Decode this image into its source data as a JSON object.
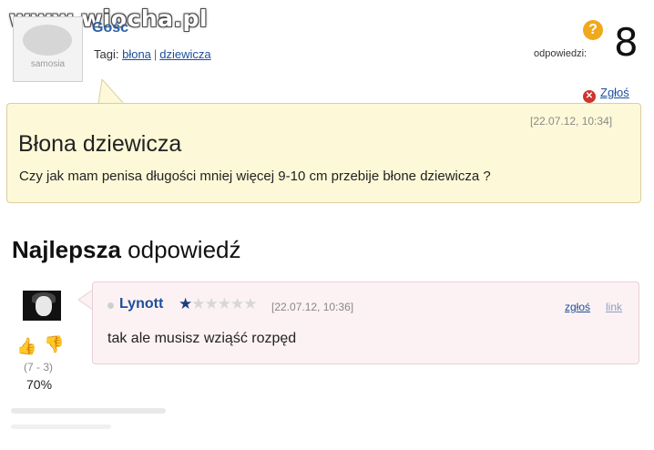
{
  "watermark": "www.wiocha.pl",
  "question": {
    "avatar_label": "samosia",
    "user_name": "Gośc",
    "tags_label": "Tagi:",
    "tags": [
      "błona",
      "dziewicza"
    ],
    "answers_label": "odpowiedzi:",
    "answers_count": "8",
    "badge": "?",
    "report_label": "Zgłoś",
    "date": "[22.07.12, 10:34]",
    "title": "Błona dziewicza",
    "body": "Czy jak mam penisa długości mniej więcej 9-10 cm przebije błone dziewicza ?"
  },
  "best_answer": {
    "heading_bold": "Najlepsza",
    "heading_rest": " odpowiedź",
    "user_name": "Lynott",
    "rating": {
      "stars_on": 1,
      "stars_total": 6
    },
    "date": "[22.07.12, 10:36]",
    "report_label": "zgłoś",
    "link_label": "link",
    "body": "tak ale musisz wziąść rozpęd",
    "votes": {
      "count": "(7 - 3)",
      "percent": "70%"
    }
  },
  "colors": {
    "question_bg": "#fdf9d8",
    "answer_bg": "#fcf2f4",
    "link": "#1b4f9c"
  },
  "icons": [
    "help-badge-icon",
    "report-x-icon",
    "thumb-up-icon",
    "thumb-down-icon",
    "star-icon"
  ]
}
